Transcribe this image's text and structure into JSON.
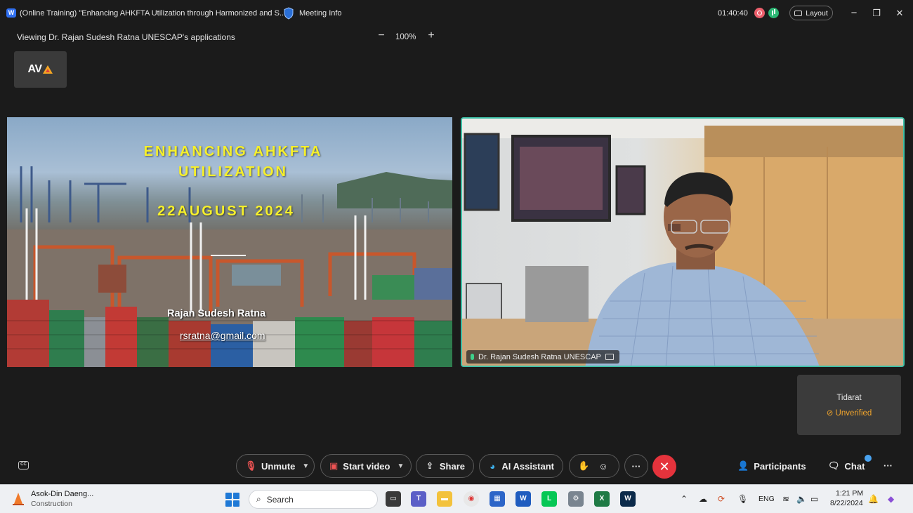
{
  "window": {
    "title": "(Online Training) \"Enhancing AHKFTA Utilization through Harmonized and S...",
    "meeting_info": "Meeting Info",
    "timer": "01:40:40",
    "layout_label": "Layout",
    "minimize": "−",
    "restore": "❐",
    "close": "✕"
  },
  "share_bar": {
    "viewing": "Viewing Dr. Rajan Sudesh Ratna UNESCAP's applications",
    "zoom_minus": "−",
    "zoom_level": "100%",
    "zoom_plus": "+"
  },
  "logo": {
    "text": "AV"
  },
  "slide": {
    "title_line1": "ENHANCING AHKFTA",
    "title_line2": "UTILIZATION",
    "date": "22AUGUST 2024",
    "presenter": "Rajan Sudesh Ratna",
    "email": "rsratna@gmail.com"
  },
  "video": {
    "label": "Dr. Rajan Sudesh Ratna UNESCAP"
  },
  "participant_tile": {
    "name": "Tidarat",
    "status": "Unverified"
  },
  "controls": {
    "unmute": "Unmute",
    "start_video": "Start video",
    "share": "Share",
    "ai_assistant": "AI Assistant",
    "more": "···",
    "leave": "✕",
    "participants": "Participants",
    "chat": "Chat",
    "more_right": "···"
  },
  "taskbar": {
    "news_title": "Asok-Din Daeng...",
    "news_sub": "Construction",
    "search_placeholder": "Search",
    "lang": "ENG",
    "time": "1:21 PM",
    "date": "8/22/2024"
  },
  "colors": {
    "accent_green": "#3dbfa6",
    "leave_red": "#e5333c",
    "slide_yellow": "#f6f02b",
    "unverified_orange": "#f2a52c"
  }
}
